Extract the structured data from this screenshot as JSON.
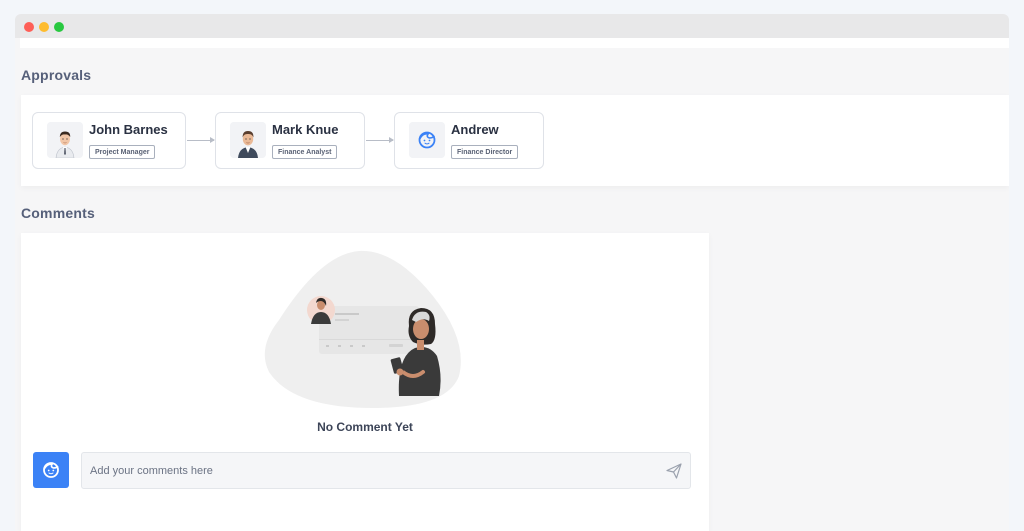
{
  "window": {
    "controls": [
      "close",
      "minimize",
      "maximize"
    ],
    "colors": {
      "close": "#fe5f57",
      "minimize": "#febc2e",
      "maximize": "#28c840"
    }
  },
  "approvals": {
    "title": "Approvals",
    "approvers": [
      {
        "name": "John Barnes",
        "role": "Project Manager",
        "avatar": "man-avatar-icon"
      },
      {
        "name": "Mark Knue",
        "role": "Finance Analyst",
        "avatar": "man-avatar-icon"
      },
      {
        "name": "Andrew",
        "role": "Finance Director",
        "avatar": "user-face-icon"
      }
    ]
  },
  "comments": {
    "title": "Comments",
    "illustration": "woman-holding-phone-illustration",
    "empty_text": "No Comment Yet",
    "input_placeholder": "Add your comments here",
    "send_icon": "paper-plane-icon",
    "accent_color": "#3b82f6"
  }
}
